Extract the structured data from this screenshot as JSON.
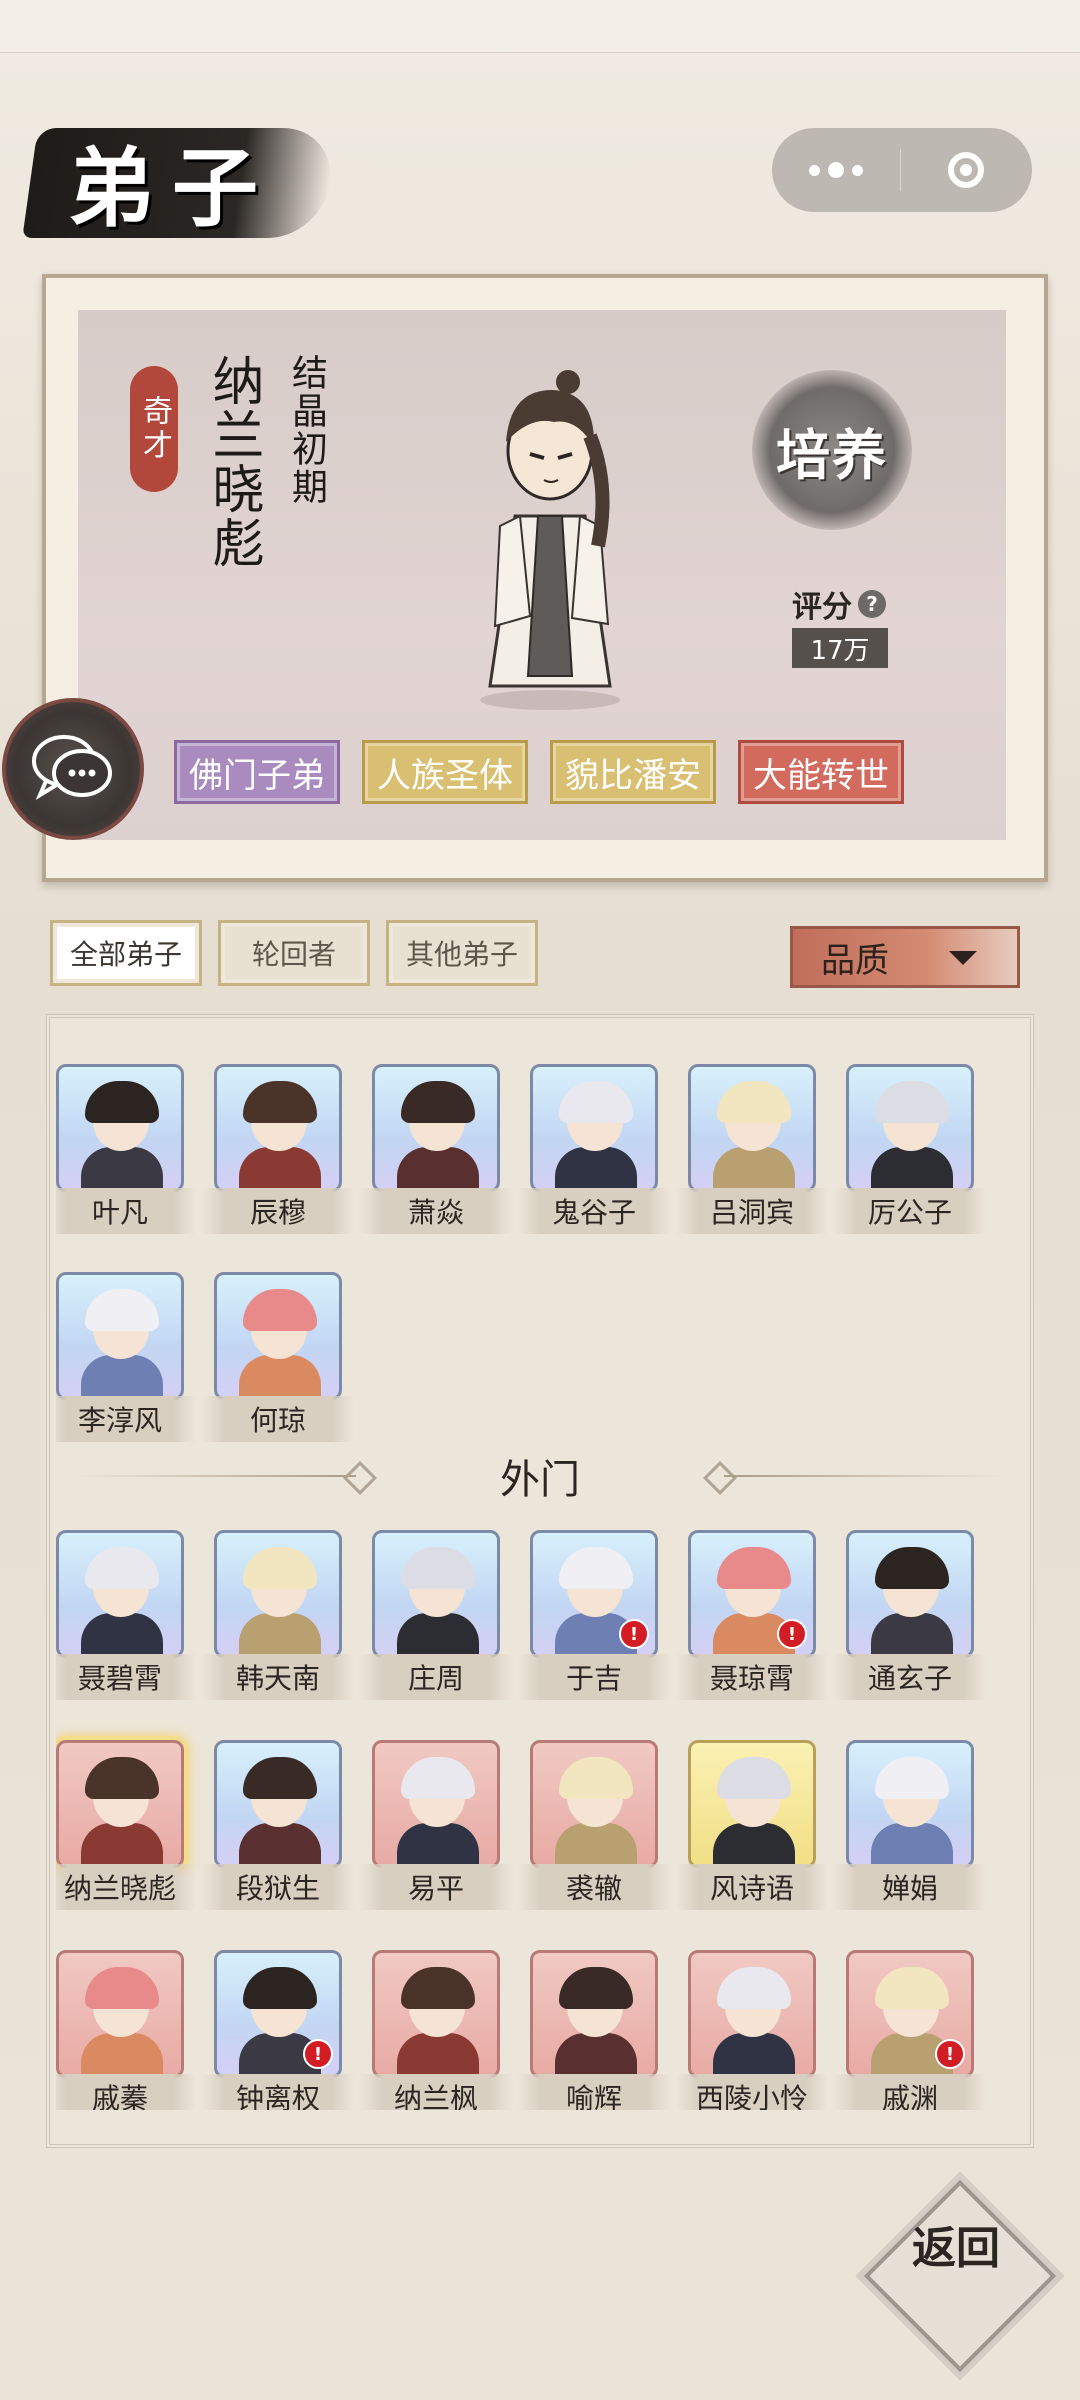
{
  "page_title": "弟子",
  "capsule": {
    "more_icon": "more-dots-icon",
    "close_icon": "record-circle-icon"
  },
  "character": {
    "rank_tag": "奇才",
    "name": "纳兰晓彪",
    "realm": "结晶初期",
    "cultivate_label": "培养",
    "score_label": "评分",
    "score_value": "17万",
    "traits": [
      "佛门子弟",
      "人族圣体",
      "貌比潘安",
      "大能转世"
    ]
  },
  "filters": {
    "tabs": [
      "全部弟子",
      "轮回者",
      "其他弟子"
    ],
    "active_tab": "全部弟子",
    "sort_label": "品质"
  },
  "roster": {
    "inner_disciples": [
      {
        "name": "叶凡",
        "frame": "blue"
      },
      {
        "name": "辰穆",
        "frame": "blue"
      },
      {
        "name": "萧焱",
        "frame": "blue"
      },
      {
        "name": "鬼谷子",
        "frame": "blue"
      },
      {
        "name": "吕洞宾",
        "frame": "blue"
      },
      {
        "name": "厉公子",
        "frame": "blue"
      },
      {
        "name": "李淳风",
        "frame": "blue"
      },
      {
        "name": "何琼",
        "frame": "blue"
      }
    ],
    "outer_section_title": "外门",
    "outer_disciples": [
      {
        "name": "聂碧霄",
        "frame": "blue",
        "alert": false
      },
      {
        "name": "韩天南",
        "frame": "blue",
        "alert": false
      },
      {
        "name": "庄周",
        "frame": "blue",
        "alert": false
      },
      {
        "name": "于吉",
        "frame": "blue",
        "alert": true
      },
      {
        "name": "聂琼霄",
        "frame": "blue",
        "alert": true
      },
      {
        "name": "通玄子",
        "frame": "blue",
        "alert": false
      },
      {
        "name": "纳兰晓彪",
        "frame": "red",
        "alert": false,
        "selected": true
      },
      {
        "name": "段狱生",
        "frame": "blue",
        "alert": false
      },
      {
        "name": "易平",
        "frame": "red",
        "alert": false
      },
      {
        "name": "裘辙",
        "frame": "red",
        "alert": false
      },
      {
        "name": "风诗语",
        "frame": "yellow",
        "alert": false
      },
      {
        "name": "婵娟",
        "frame": "blue",
        "alert": false
      },
      {
        "name": "戚蓁",
        "frame": "red",
        "alert": false
      },
      {
        "name": "钟离权",
        "frame": "blue",
        "alert": true
      },
      {
        "name": "纳兰枫",
        "frame": "red",
        "alert": false
      },
      {
        "name": "喻辉",
        "frame": "red",
        "alert": false
      },
      {
        "name": "西陵小怜",
        "frame": "red",
        "alert": false
      },
      {
        "name": "戚渊",
        "frame": "red",
        "alert": true
      }
    ],
    "alert_glyph": "!"
  },
  "back_button": {
    "label": "返回"
  },
  "colors": {
    "accent_red": "#b2473c",
    "alert": "#d21d24",
    "frame_blue": "#7c8aa8"
  }
}
